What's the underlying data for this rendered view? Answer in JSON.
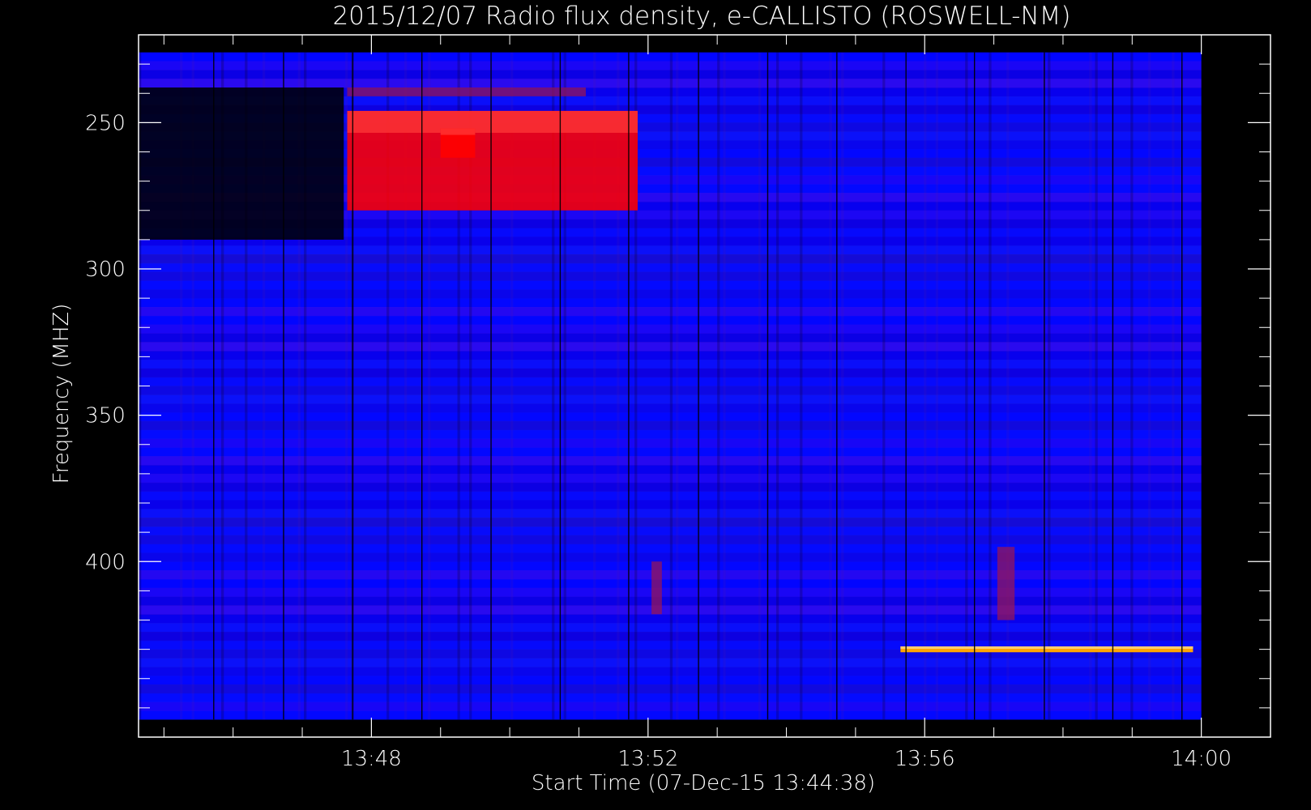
{
  "chart_data": {
    "type": "heatmap",
    "title": "2015/12/07  Radio flux density, e-CALLISTO (ROSWELL-NM)",
    "xlabel": "Start Time (07-Dec-15 13:44:38)",
    "ylabel": "Frequency (MHZ)",
    "x_ticks": [
      {
        "label": "13:48",
        "minutes": 228
      },
      {
        "label": "13:52",
        "minutes": 232
      },
      {
        "label": "13:56",
        "minutes": 236
      },
      {
        "label": "14:00",
        "minutes": 240
      }
    ],
    "y_ticks": [
      250,
      300,
      350,
      400
    ],
    "xlim_minutes": [
      224.633,
      241.0
    ],
    "ylim_mhz": [
      220,
      460
    ],
    "data_extent": {
      "start_minutes": 224.633,
      "end_minutes": 240.0,
      "freq_top_mhz": 226,
      "freq_bottom_mhz": 454
    },
    "colormap": {
      "low": "#000000",
      "mid": "#0000ff",
      "high": "#ff0000",
      "peak": "#ffa500",
      "background_levels": [
        "#0a1aff",
        "#2030ee",
        "#6618d8",
        "#341b9c",
        "#2200b0"
      ]
    },
    "features": [
      {
        "kind": "burst",
        "start": 227.65,
        "end": 231.85,
        "freq_low": 246,
        "freq_high": 280,
        "level": "high"
      },
      {
        "kind": "burst",
        "start": 227.65,
        "end": 231.1,
        "freq_low": 238,
        "freq_high": 241,
        "level": "medium"
      },
      {
        "kind": "burst",
        "start": 229.0,
        "end": 229.5,
        "freq_low": 252,
        "freq_high": 262,
        "level": "high"
      },
      {
        "kind": "gap",
        "start": 224.633,
        "end": 227.6,
        "freq_low": 238,
        "freq_high": 290,
        "level": "low"
      },
      {
        "kind": "spike",
        "start": 232.05,
        "end": 232.2,
        "freq_low": 400,
        "freq_high": 418,
        "level": "medium"
      },
      {
        "kind": "spike",
        "start": 237.05,
        "end": 237.3,
        "freq_low": 395,
        "freq_high": 420,
        "level": "medium"
      },
      {
        "kind": "interference",
        "start": 235.65,
        "end": 239.88,
        "freq_low": 429,
        "freq_high": 431,
        "level": "peak"
      }
    ],
    "vertical_markers_minutes": [
      225.72,
      226.73,
      227.73,
      228.73,
      229.73,
      230.73,
      231.72,
      232.73,
      233.73,
      234.73,
      235.73,
      236.72,
      237.73,
      238.72,
      239.72
    ],
    "grid": false,
    "legend": "none"
  }
}
